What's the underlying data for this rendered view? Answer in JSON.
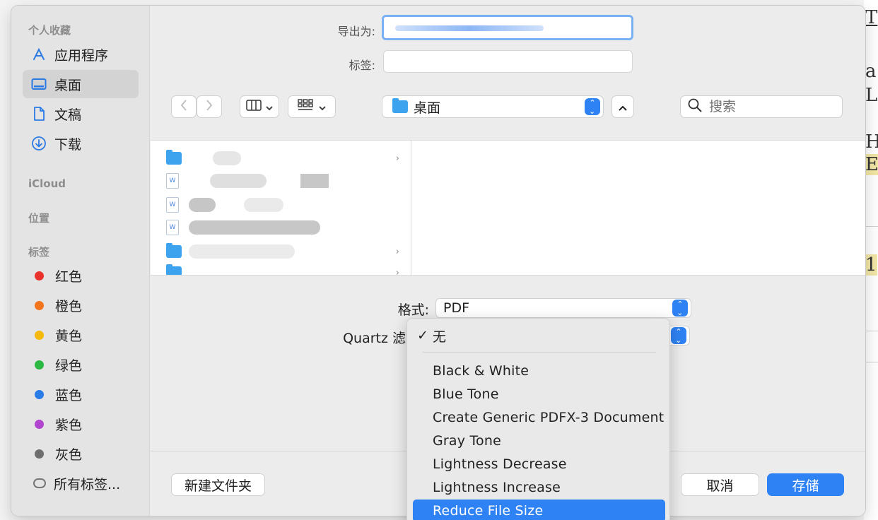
{
  "sidebar": {
    "favorites_title": "个人收藏",
    "favorites": [
      {
        "label": "应用程序",
        "icon": "apps-icon"
      },
      {
        "label": "桌面",
        "icon": "desktop-icon",
        "selected": true
      },
      {
        "label": "文稿",
        "icon": "document-icon"
      },
      {
        "label": "下载",
        "icon": "download-icon"
      }
    ],
    "icloud_title": "iCloud",
    "locations_title": "位置",
    "tags_title": "标签",
    "tags": [
      {
        "label": "红色",
        "color": "#e8322c"
      },
      {
        "label": "橙色",
        "color": "#f2741d"
      },
      {
        "label": "黄色",
        "color": "#f4b90a"
      },
      {
        "label": "绿色",
        "color": "#2db843"
      },
      {
        "label": "蓝色",
        "color": "#2a7be6"
      },
      {
        "label": "紫色",
        "color": "#b045cf"
      },
      {
        "label": "灰色",
        "color": "#6e6e6e"
      }
    ],
    "all_tags": "所有标签..."
  },
  "export": {
    "export_as_label": "导出为:",
    "tags_label": "标签:"
  },
  "toolbar": {
    "location": "桌面",
    "search_placeholder": "搜索"
  },
  "options": {
    "format_label": "格式:",
    "format_value": "PDF",
    "quartz_label": "Quartz 滤镜"
  },
  "quartz_menu": {
    "checked_item": "无",
    "items": [
      "Black & White",
      "Blue Tone",
      "Create Generic PDFX-3 Document",
      "Gray Tone",
      "Lightness Decrease",
      "Lightness Increase",
      "Reduce File Size"
    ],
    "highlighted": "Reduce File Size"
  },
  "buttons": {
    "new_folder": "新建文件夹",
    "cancel": "取消",
    "save": "存储"
  },
  "colors": {
    "accent": "#2f82f3"
  }
}
